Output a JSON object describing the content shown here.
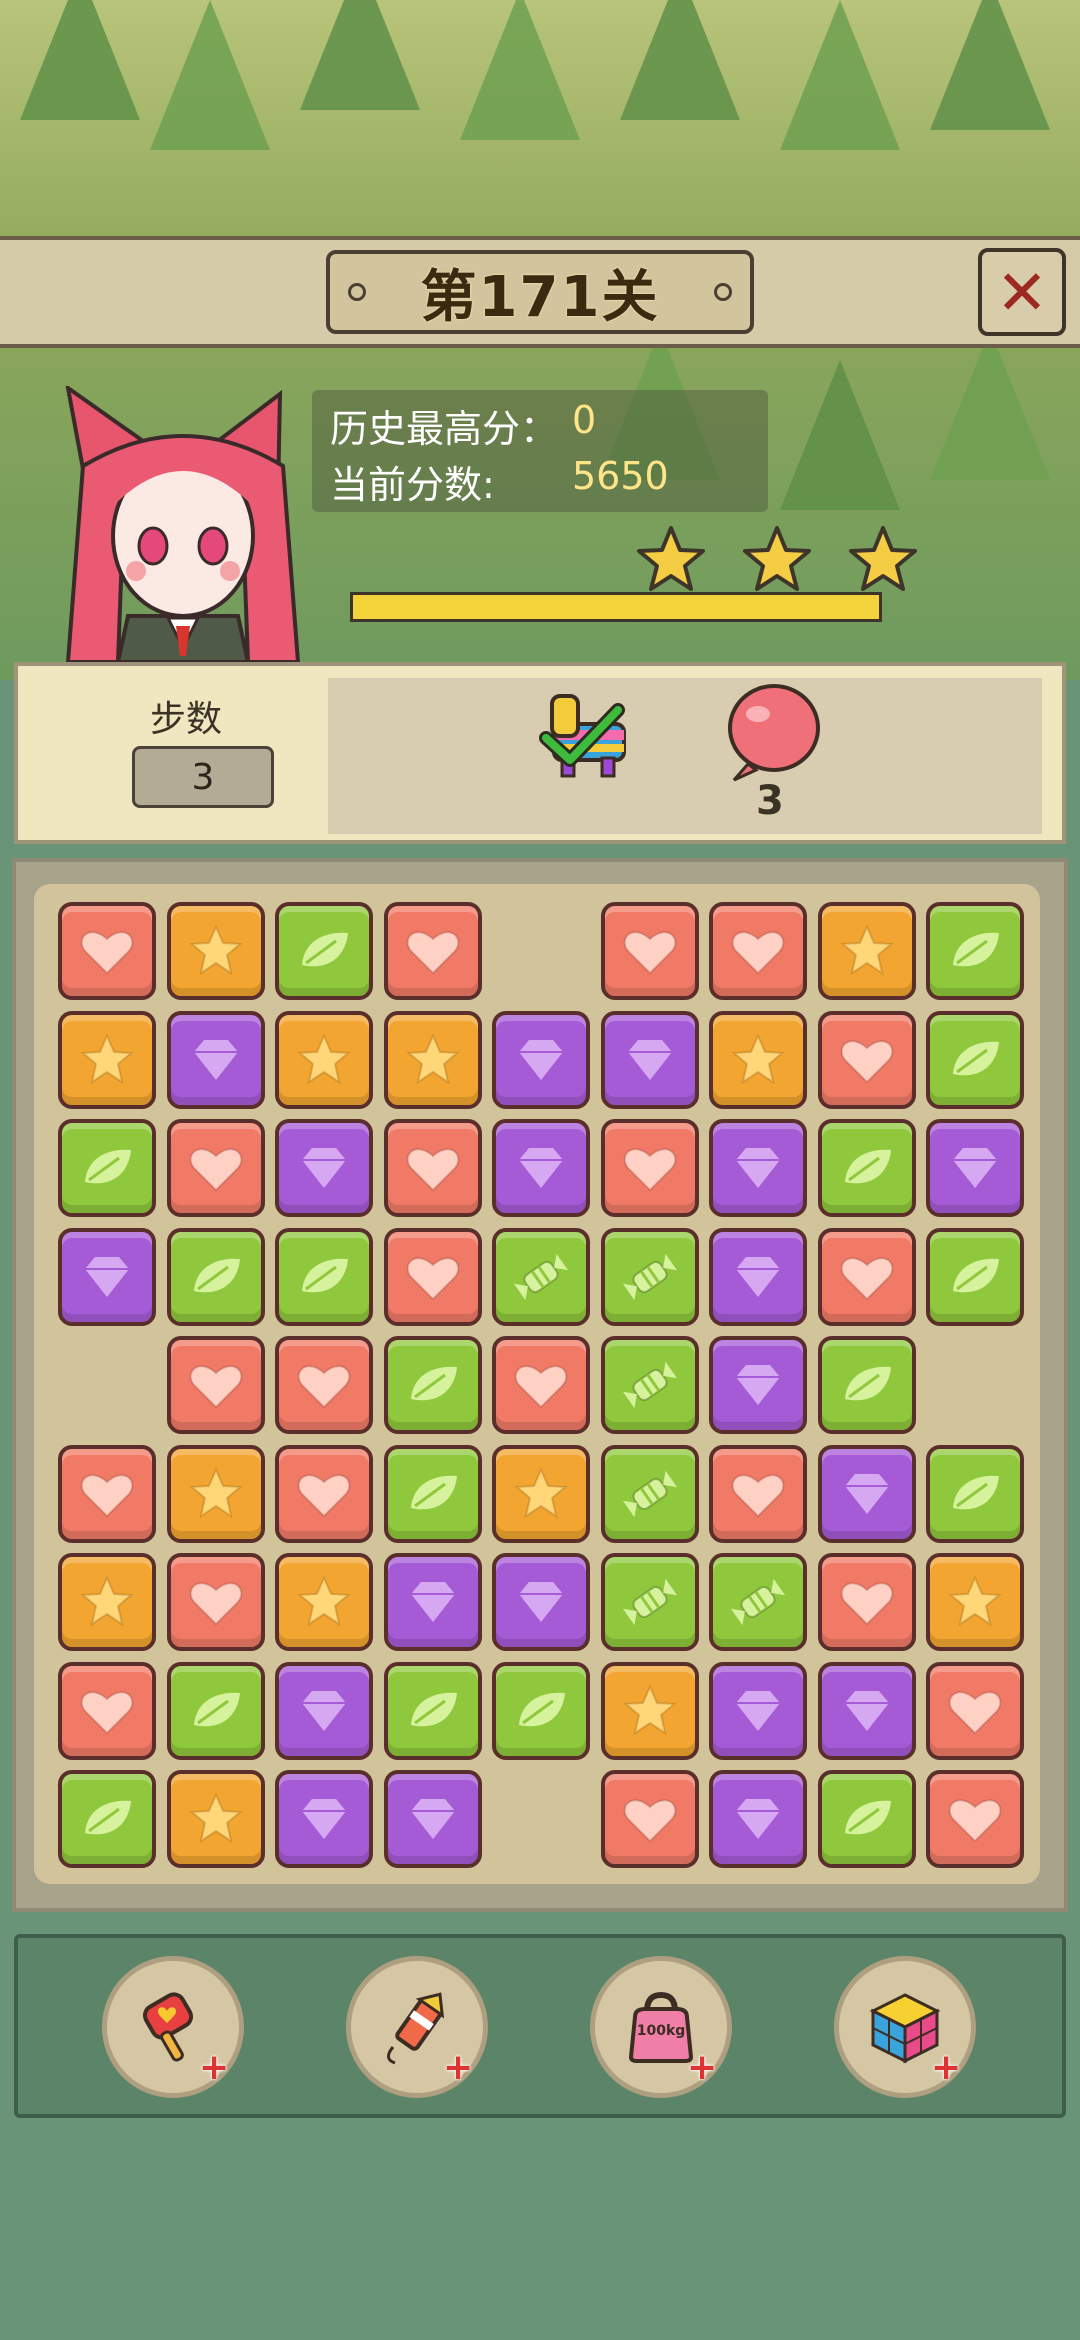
{
  "level": {
    "title": "第171关"
  },
  "close_button": {
    "label": "✕"
  },
  "scores": {
    "best_label": "历史最高分：",
    "best_value": "0",
    "current_label": "当前分数:",
    "current_value": "5650"
  },
  "progress": {
    "stars_earned": 3,
    "fill_fraction": 1.0
  },
  "goals": {
    "steps_label": "步数",
    "steps_value": "3",
    "items": [
      {
        "icon": "pinata-icon",
        "status": "completed"
      },
      {
        "icon": "balloon-icon",
        "count": "3"
      }
    ]
  },
  "board": {
    "rows": [
      [
        "heart",
        "star",
        "leaf",
        "heart",
        "",
        "heart",
        "heart",
        "star",
        "leaf"
      ],
      [
        "star",
        "gem",
        "star",
        "star",
        "gem",
        "gem",
        "star",
        "heart",
        "leaf"
      ],
      [
        "leaf",
        "heart",
        "gem",
        "heart",
        "gem",
        "heart",
        "gem",
        "leaf",
        "gem"
      ],
      [
        "gem",
        "leaf",
        "leaf",
        "heart",
        "candy",
        "candy",
        "gem",
        "heart",
        "leaf"
      ],
      [
        "",
        "heart",
        "heart",
        "leaf",
        "heart",
        "candy",
        "gem",
        "leaf",
        ""
      ],
      [
        "heart",
        "star",
        "heart",
        "leaf",
        "star",
        "candy",
        "heart",
        "gem",
        "leaf"
      ],
      [
        "star",
        "heart",
        "star",
        "gem",
        "gem",
        "candy",
        "candy",
        "heart",
        "star"
      ],
      [
        "heart",
        "leaf",
        "gem",
        "leaf",
        "leaf",
        "star",
        "gem",
        "gem",
        "heart"
      ],
      [
        "leaf",
        "star",
        "gem",
        "gem",
        "",
        "heart",
        "gem",
        "leaf",
        "heart"
      ]
    ],
    "colors": {
      "heart": "#f07a66",
      "star": "#f2a530",
      "leaf": "#8fc83c",
      "gem": "#a65bd6",
      "candy": "#8fc83c"
    }
  },
  "boosters": [
    {
      "icon": "heart-hammer-icon"
    },
    {
      "icon": "firework-rocket-icon"
    },
    {
      "icon": "weight-100kg-icon",
      "text": "100kg"
    },
    {
      "icon": "rainbow-cube-icon"
    }
  ]
}
